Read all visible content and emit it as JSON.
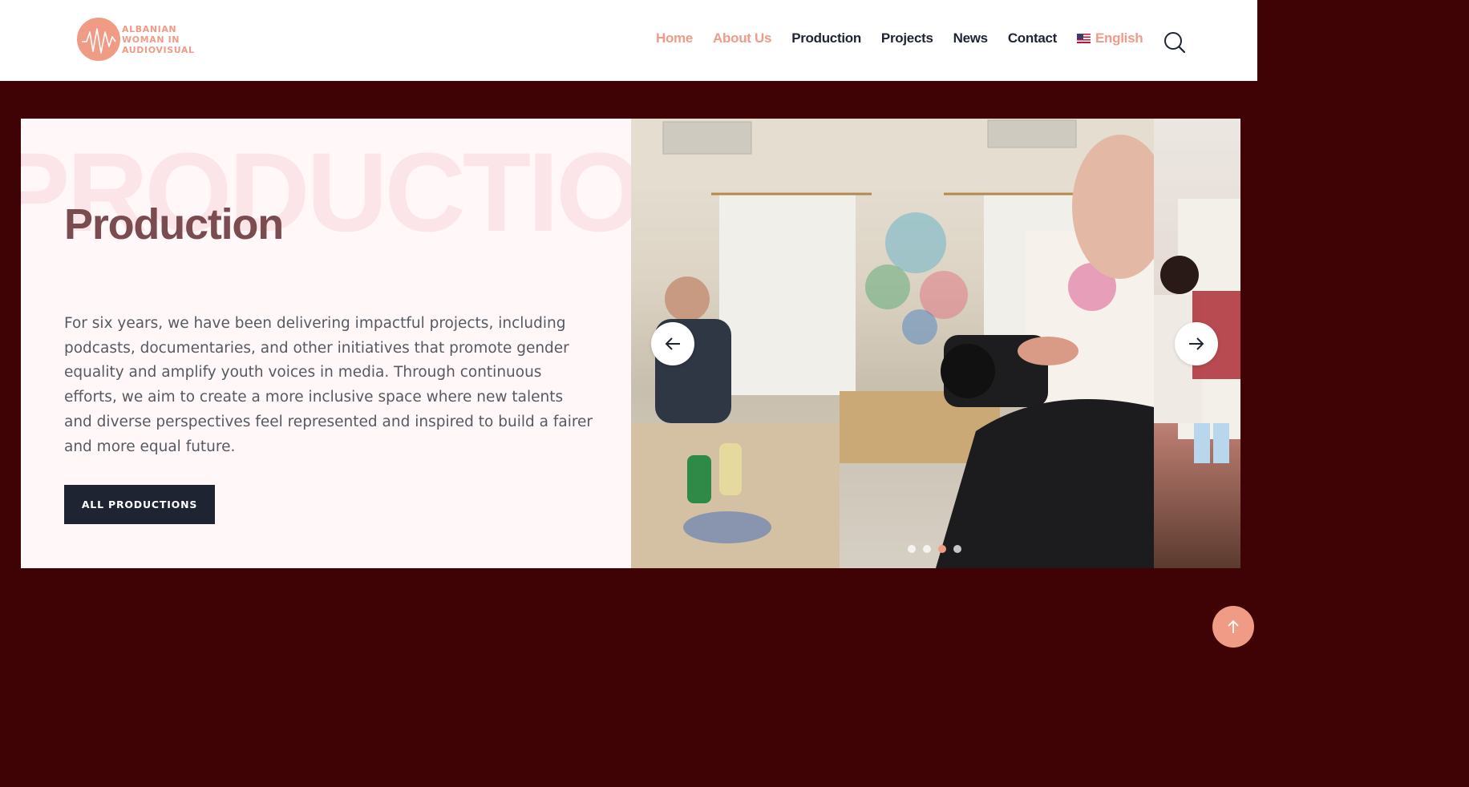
{
  "brand": {
    "logo_lines": [
      "ALBANIAN",
      "WOMAN IN",
      "AUDIOVISUAL"
    ],
    "accent_color": "#ef9b85"
  },
  "nav": {
    "items": [
      {
        "label": "Home",
        "state": "active"
      },
      {
        "label": "About Us",
        "state": "highlighted"
      },
      {
        "label": "Production"
      },
      {
        "label": "Projects"
      },
      {
        "label": "News"
      },
      {
        "label": "Contact"
      }
    ],
    "language": {
      "label": "English",
      "icon": "us-flag-icon"
    },
    "search_icon": "search-icon"
  },
  "section": {
    "background_word": "PRODUCTION",
    "title": "Production",
    "description": "For six years, we have been delivering impactful projects, including podcasts, documentaries, and other initiatives that promote gender equality and amplify youth voices in media. Through continuous efforts, we aim to create a more inclusive space where new talents and diverse perspectives feel represented and inspired to build a fairer and more equal future.",
    "cta_label": "ALL PRODUCTIONS"
  },
  "slider": {
    "slide_count": 4,
    "active_slide": 3,
    "prev_icon": "arrow-left-icon",
    "next_icon": "arrow-right-icon"
  },
  "back_to_top_icon": "arrow-up-icon",
  "colors": {
    "page_background": "#3f0205",
    "card_background": "#fff7f8",
    "button_dark": "#1e2431",
    "title_color": "#7a4c50"
  }
}
